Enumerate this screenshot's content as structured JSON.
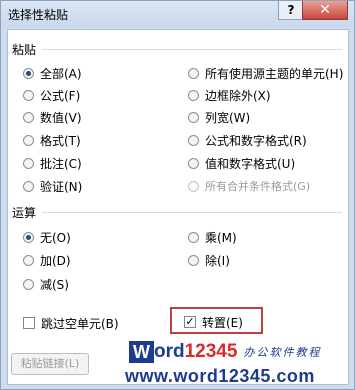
{
  "window": {
    "title": "选择性粘贴",
    "help_label": "?",
    "close_label": "✕"
  },
  "paste_group": {
    "label": "粘贴",
    "left_options": [
      "全部(A)",
      "公式(F)",
      "数值(V)",
      "格式(T)",
      "批注(C)",
      "验证(N)"
    ],
    "right_options": [
      "所有使用源主题的单元(H)",
      "边框除外(X)",
      "列宽(W)",
      "公式和数字格式(R)",
      "值和数字格式(U)",
      "所有合并条件格式(G)"
    ],
    "selected": "全部(A)"
  },
  "operation_group": {
    "label": "运算",
    "left_options": [
      "无(O)",
      "加(D)",
      "减(S)"
    ],
    "right_options": [
      "乘(M)",
      "除(I)"
    ],
    "selected": "无(O)"
  },
  "checkboxes": {
    "skip_blanks": {
      "label": "跳过空单元(B)",
      "checked": false
    },
    "transpose": {
      "label": "转置(E)",
      "checked": true
    }
  },
  "buttons": {
    "paste_link": "粘贴链接(L)"
  },
  "watermark": {
    "w": "W",
    "brand_word": "ord",
    "brand_num": "12345",
    "tagline": "办公软件教程",
    "url": "www.word12345.com"
  }
}
